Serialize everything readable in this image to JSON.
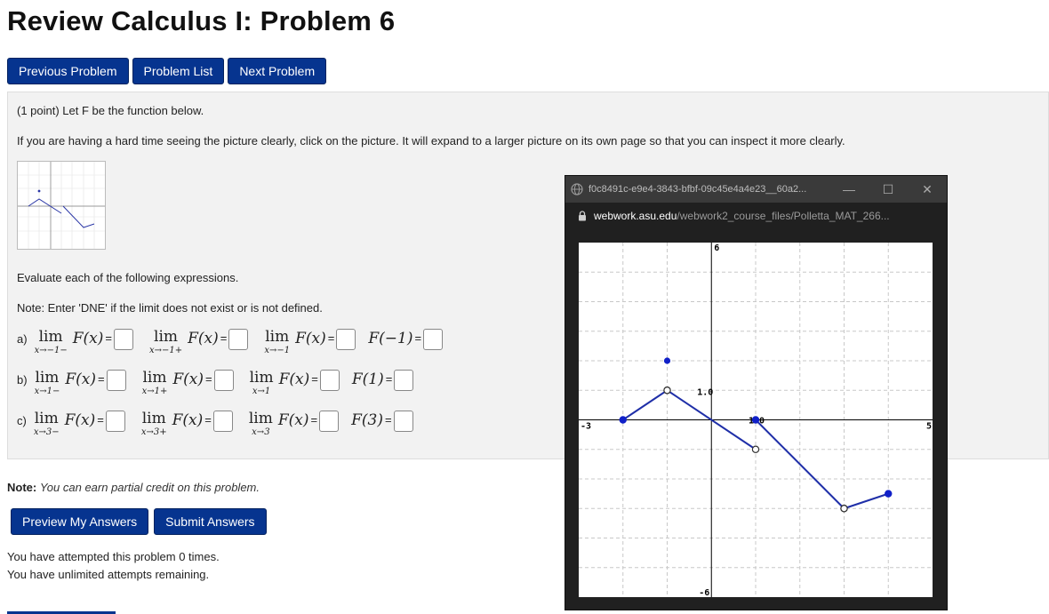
{
  "page": {
    "title": "Review Calculus I: Problem 6"
  },
  "nav": {
    "previous": "Previous Problem",
    "list": "Problem List",
    "next": "Next Problem"
  },
  "problem": {
    "intro": "(1 point) Let F be the function below.",
    "instructions": "If you are having a hard time seeing the picture clearly, click on the picture. It will expand to a larger picture on its own page so that you can inspect it more clearly.",
    "evaluate": "Evaluate each of the following expressions.",
    "note": "Note: Enter 'DNE' if the limit does not exist or is not defined.",
    "rows": [
      {
        "label": "a)",
        "lim": "lim",
        "eq": "=",
        "fx": "F(x)",
        "subs": [
          "x→−1−",
          "x→−1+",
          "x→−1"
        ],
        "point": "F(−1)"
      },
      {
        "label": "b)",
        "lim": "lim",
        "eq": "=",
        "fx": "F(x)",
        "subs": [
          "x→1−",
          "x→1+",
          "x→1"
        ],
        "point": "F(1)"
      },
      {
        "label": "c)",
        "lim": "lim",
        "eq": "=",
        "fx": "F(x)",
        "subs": [
          "x→3−",
          "x→3+",
          "x→3"
        ],
        "point": "F(3)"
      }
    ]
  },
  "footer": {
    "note_label": "Note:",
    "note_text": "You can earn partial credit on this problem.",
    "preview": "Preview My Answers",
    "submit": "Submit Answers",
    "attempts": "You have attempted this problem 0 times.",
    "remaining": "You have unlimited attempts remaining."
  },
  "popup": {
    "title": "f0c8491c-e9e4-3843-bfbf-09c45e4a4e23__60a2...",
    "url_host": "webwork.asu.edu",
    "url_path": "/webwork2_course_files/Polletta_MAT_266...",
    "minimize": "—",
    "maximize": "☐",
    "close": "✕"
  },
  "colors": {
    "button": "#06348f",
    "plot_line": "#1f2fa8",
    "plot_point": "#1020c8"
  },
  "chart_data": {
    "type": "line",
    "xlim": [
      -3,
      5
    ],
    "ylim": [
      -6,
      6
    ],
    "grid": true,
    "tick_labels": {
      "xmin": "-3",
      "xmax": "5",
      "ymax": "6",
      "ymin": "-6",
      "x_one": "1.0",
      "y_one": "1.0"
    },
    "segments": [
      {
        "from": [
          -2,
          0
        ],
        "to": [
          -1,
          1
        ],
        "from_closed": true,
        "to_closed": false
      },
      {
        "from": [
          -1,
          1
        ],
        "to": [
          1,
          -1
        ],
        "from_closed": false,
        "to_closed": false
      },
      {
        "from": [
          1,
          0
        ],
        "to": [
          3,
          -3
        ],
        "from_closed": true,
        "to_closed": false
      },
      {
        "from": [
          3,
          -3
        ],
        "to": [
          4,
          -2.5
        ],
        "from_closed": false,
        "to_closed": true
      }
    ],
    "isolated_points": [
      [
        -1,
        2
      ]
    ]
  }
}
